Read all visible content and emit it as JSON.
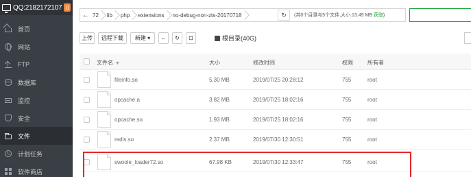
{
  "sidebar": {
    "brand": {
      "label": "QQ:2182172107",
      "badge": "0"
    },
    "items": [
      {
        "label": "首页",
        "icon": "home-icon",
        "active": false
      },
      {
        "label": "网站",
        "icon": "globe-icon",
        "active": false
      },
      {
        "label": "FTP",
        "icon": "ftp-icon",
        "active": false
      },
      {
        "label": "数据库",
        "icon": "database-icon",
        "active": false
      },
      {
        "label": "监控",
        "icon": "monitor-icon",
        "active": false
      },
      {
        "label": "安全",
        "icon": "shield-icon",
        "active": false
      },
      {
        "label": "文件",
        "icon": "folder-icon",
        "active": true
      },
      {
        "label": "计划任务",
        "icon": "clock-icon",
        "active": false
      },
      {
        "label": "软件商店",
        "icon": "grid-icon",
        "active": false
      }
    ]
  },
  "pathbar": {
    "back": "←",
    "crumbs": [
      "72",
      "lib",
      "php",
      "extensions",
      "no-debug-non-zts-20170718"
    ],
    "refresh": "↻",
    "summary_prefix": "(共0个目录与5个文件,大小:13.49 MB ",
    "summary_link": "获取",
    "summary_suffix": ")"
  },
  "toolbar": {
    "upload": "上传",
    "remote_download": "远程下载",
    "new": "新建 ▾",
    "back": "←",
    "refresh": "↻",
    "terminal": "⊡",
    "disk": "根目录(40G)"
  },
  "table": {
    "headers": {
      "name": "文件名",
      "size": "大小",
      "modified": "修改时间",
      "permission": "权限",
      "owner": "所有者"
    },
    "rows": [
      {
        "name": "fileinfo.so",
        "size": "5.30 MB",
        "modified": "2019/07/25 20:28:12",
        "permission": "755",
        "owner": "root"
      },
      {
        "name": "opcache.a",
        "size": "3.82 MB",
        "modified": "2019/07/25 18:02:16",
        "permission": "755",
        "owner": "root"
      },
      {
        "name": "opcache.so",
        "size": "1.93 MB",
        "modified": "2019/07/25 18:02:16",
        "permission": "755",
        "owner": "root"
      },
      {
        "name": "redis.so",
        "size": "2.37 MB",
        "modified": "2019/07/30 12:30:51",
        "permission": "755",
        "owner": "root"
      },
      {
        "name": "swoole_loader72.so",
        "size": "67.98 KB",
        "modified": "2019/07/30 12:33:47",
        "permission": "755",
        "owner": "root"
      }
    ]
  },
  "colors": {
    "sidebar": "#3a3f45",
    "accent": "#20a53a",
    "highlight": "#e3262b",
    "badge": "#f0883a"
  }
}
